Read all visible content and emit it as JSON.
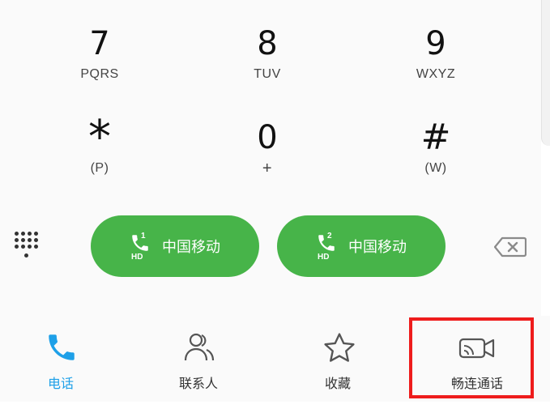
{
  "keypad": {
    "row3": [
      {
        "digit": "7",
        "letters": "PQRS"
      },
      {
        "digit": "8",
        "letters": "TUV"
      },
      {
        "digit": "9",
        "letters": "WXYZ"
      }
    ],
    "row4": [
      {
        "digit": "*",
        "letters": "(P)"
      },
      {
        "digit": "0",
        "letters": "+"
      },
      {
        "digit": "#",
        "letters": "(W)"
      }
    ]
  },
  "calls": [
    {
      "sim": "1",
      "hd": "HD",
      "carrier": "中国移动"
    },
    {
      "sim": "2",
      "hd": "HD",
      "carrier": "中国移动"
    }
  ],
  "tabs": [
    {
      "label": "电话",
      "icon": "phone-icon",
      "active": true
    },
    {
      "label": "联系人",
      "icon": "contacts-icon",
      "active": false
    },
    {
      "label": "收藏",
      "icon": "star-icon",
      "active": false
    },
    {
      "label": "畅连通话",
      "icon": "video-call-icon",
      "active": false
    }
  ],
  "colors": {
    "call_green": "#47b449",
    "active_tab": "#1ea0e8",
    "highlight": "#ee1c1c"
  }
}
